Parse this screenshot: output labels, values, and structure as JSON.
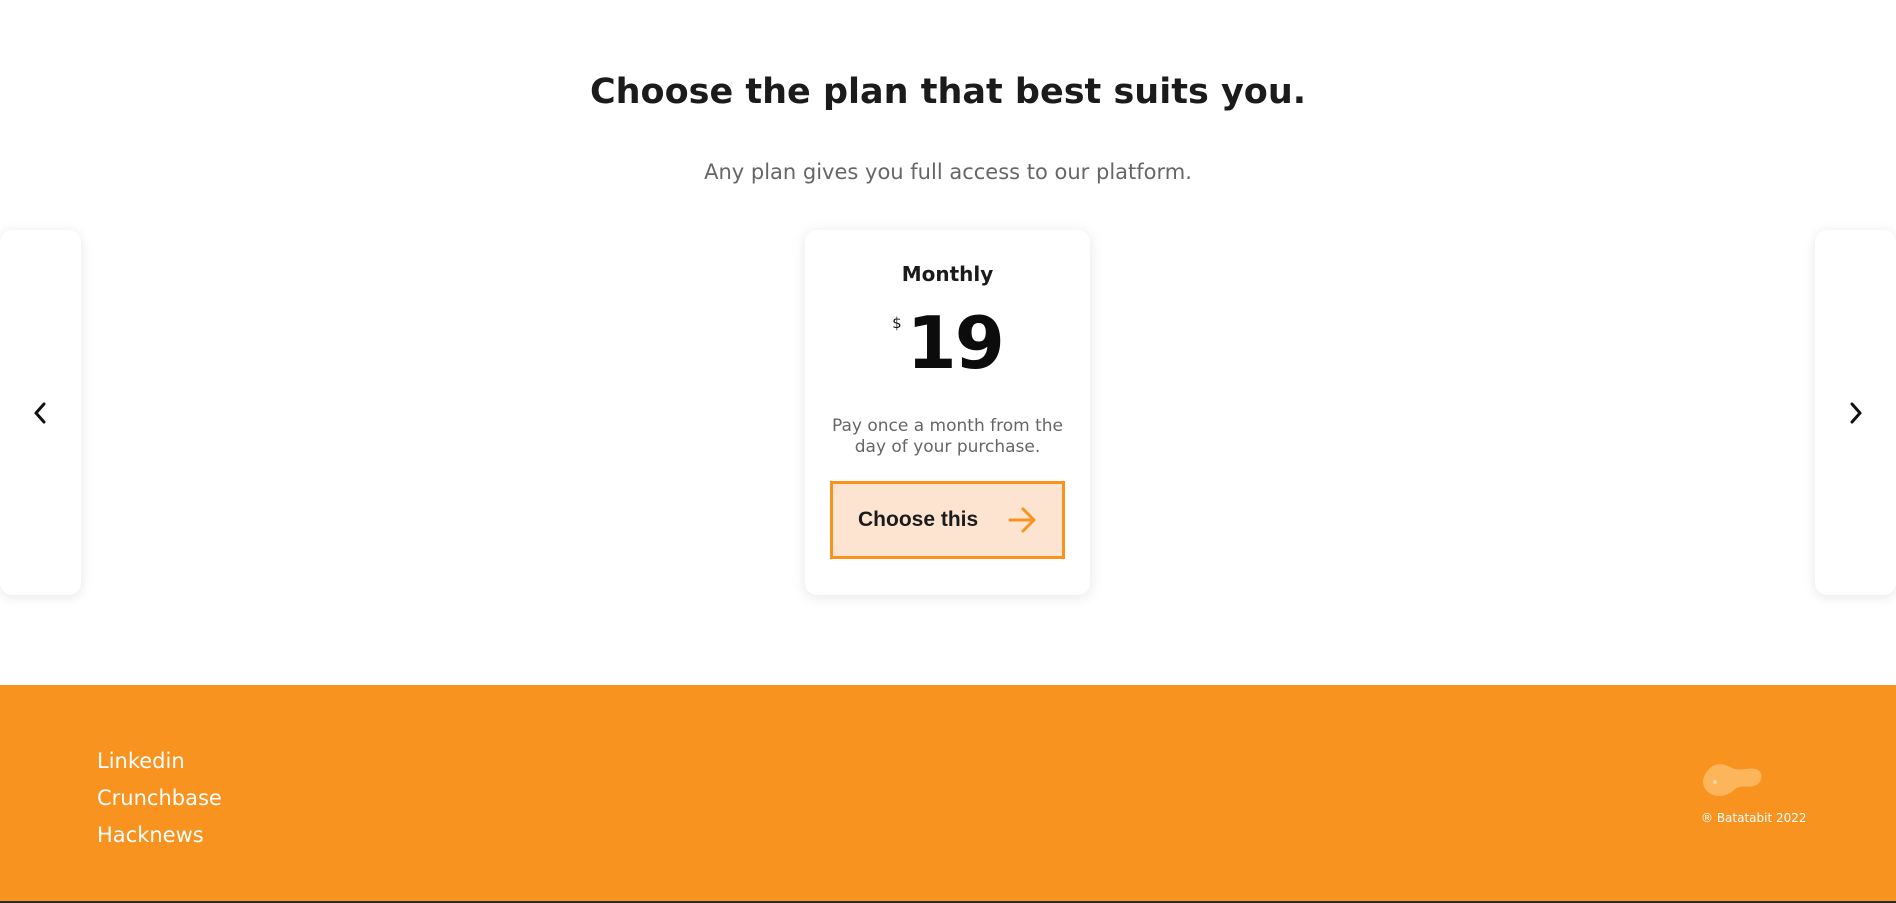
{
  "pricing": {
    "title": "Choose the plan that best suits you.",
    "subtitle": "Any plan gives you full access to our platform.",
    "nav": {
      "prev_icon": "chevron-left-icon",
      "next_icon": "chevron-right-icon"
    },
    "plans": [
      {
        "name": "Monthly",
        "currency": "$",
        "price": "19",
        "description": "Pay once a month from the day of your purchase.",
        "cta_label": "Choose this",
        "cta_icon": "arrow-right-icon"
      }
    ]
  },
  "footer": {
    "links": [
      "Linkedin",
      "Crunchbase",
      "Hacknews"
    ],
    "logo_icon": "batatabit-logo-icon",
    "copyright": "® Batatabit 2022"
  },
  "colors": {
    "accent": "#f7931e",
    "button_bg": "#fde4d0",
    "heading": "#1b1b1b",
    "muted_text": "#666666",
    "footer_bg": "#f7931e",
    "logo": "#fdb55b"
  }
}
